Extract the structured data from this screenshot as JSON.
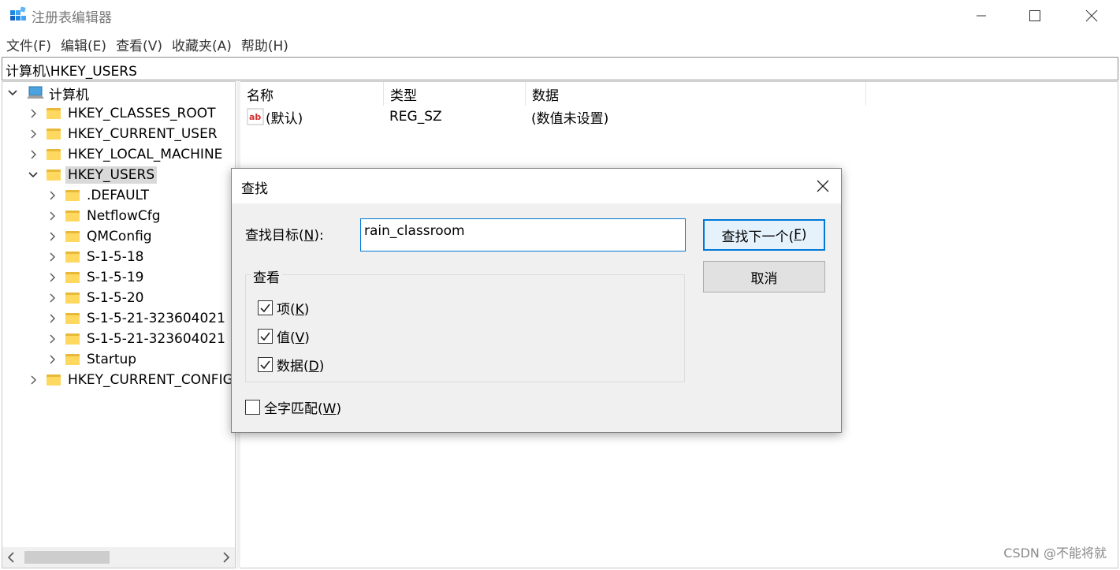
{
  "window": {
    "title": "注册表编辑器",
    "minimize_glyph": "—",
    "maximize_glyph": "☐",
    "close_glyph": "✕"
  },
  "menu": [
    "文件(F)",
    "编辑(E)",
    "查看(V)",
    "收藏夹(A)",
    "帮助(H)"
  ],
  "address": "计算机\\HKEY_USERS",
  "tree": {
    "root": "计算机",
    "items": [
      "HKEY_CLASSES_ROOT",
      "HKEY_CURRENT_USER",
      "HKEY_LOCAL_MACHINE",
      "HKEY_USERS",
      ".DEFAULT",
      "NetflowCfg",
      "QMConfig",
      "S-1-5-18",
      "S-1-5-19",
      "S-1-5-20",
      "S-1-5-21-323604021",
      "S-1-5-21-323604021",
      "Startup",
      "HKEY_CURRENT_CONFIG"
    ],
    "selected": "HKEY_USERS"
  },
  "list": {
    "columns": {
      "name": "名称",
      "type": "类型",
      "data": "数据"
    },
    "rows": [
      {
        "name": "(默认)",
        "type": "REG_SZ",
        "data": "(数值未设置)"
      }
    ]
  },
  "dialog": {
    "title": "查找",
    "find_label_prefix": "查找目标(",
    "find_label_key": "N",
    "find_label_suffix": "):",
    "find_value": "rain_classroom",
    "find_next_prefix": "查找下一个(",
    "find_next_key": "F",
    "find_next_suffix": ")",
    "cancel": "取消",
    "look_at_label": "查看",
    "keys_prefix": "项(",
    "keys_key": "K",
    "keys_checked": true,
    "values_prefix": "值(",
    "values_key": "V",
    "values_checked": true,
    "data_prefix": "数据(",
    "data_key": "D",
    "data_checked": true,
    "match_whole_prefix": "全字匹配(",
    "match_whole_key": "W",
    "match_whole_checked": false,
    "paren_close": ")"
  },
  "watermark": "CSDN @不能将就"
}
